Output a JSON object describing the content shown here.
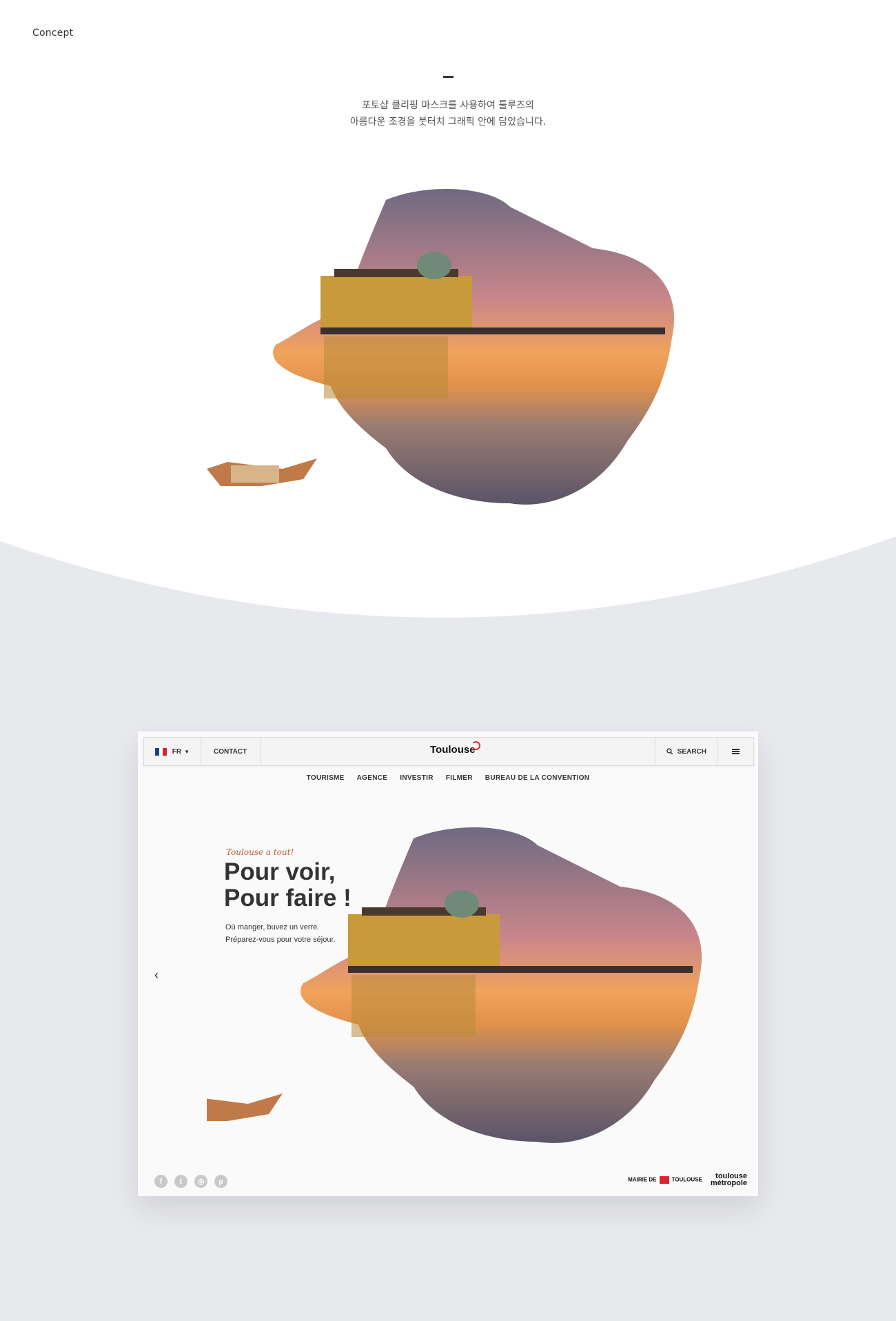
{
  "concept": {
    "label": "Concept"
  },
  "description": {
    "line1": "포토샵 클리핑 마스크를 사용하여 툴루즈의",
    "line2": "아름다운 조경을 붓터치 그래픽 안에 담았습니다."
  },
  "colors": {
    "background_gray": "#e8e9ed",
    "accent_red": "#e0303a",
    "tagline": "#c45a3c"
  },
  "mockup": {
    "nav": {
      "language": "FR",
      "contact": "CONTACT",
      "logo": "Toulouse",
      "search": "SEARCH",
      "icons": [
        "flag-icon",
        "chevron-down-icon",
        "search-icon",
        "menu-icon"
      ]
    },
    "subnav": [
      "TOURISME",
      "AGENCE",
      "INVESTIR",
      "FILMER",
      "BUREAU DE LA CONVENTION"
    ],
    "hero": {
      "tagline": "Toulouse a tout!",
      "headline1": "Pour voir,",
      "headline2": "Pour faire !",
      "sub1": "Où manger, buvez un verre.",
      "sub2": "Préparez-vous pour votre séjour."
    },
    "socials": [
      "facebook-icon",
      "twitter-icon",
      "instagram-icon",
      "pinterest-icon"
    ],
    "partners": {
      "mairie_de": "MAIRIE DE",
      "toulouse": "TOULOUSE",
      "metro_line1": "toulouse",
      "metro_line2": "métropole"
    }
  }
}
